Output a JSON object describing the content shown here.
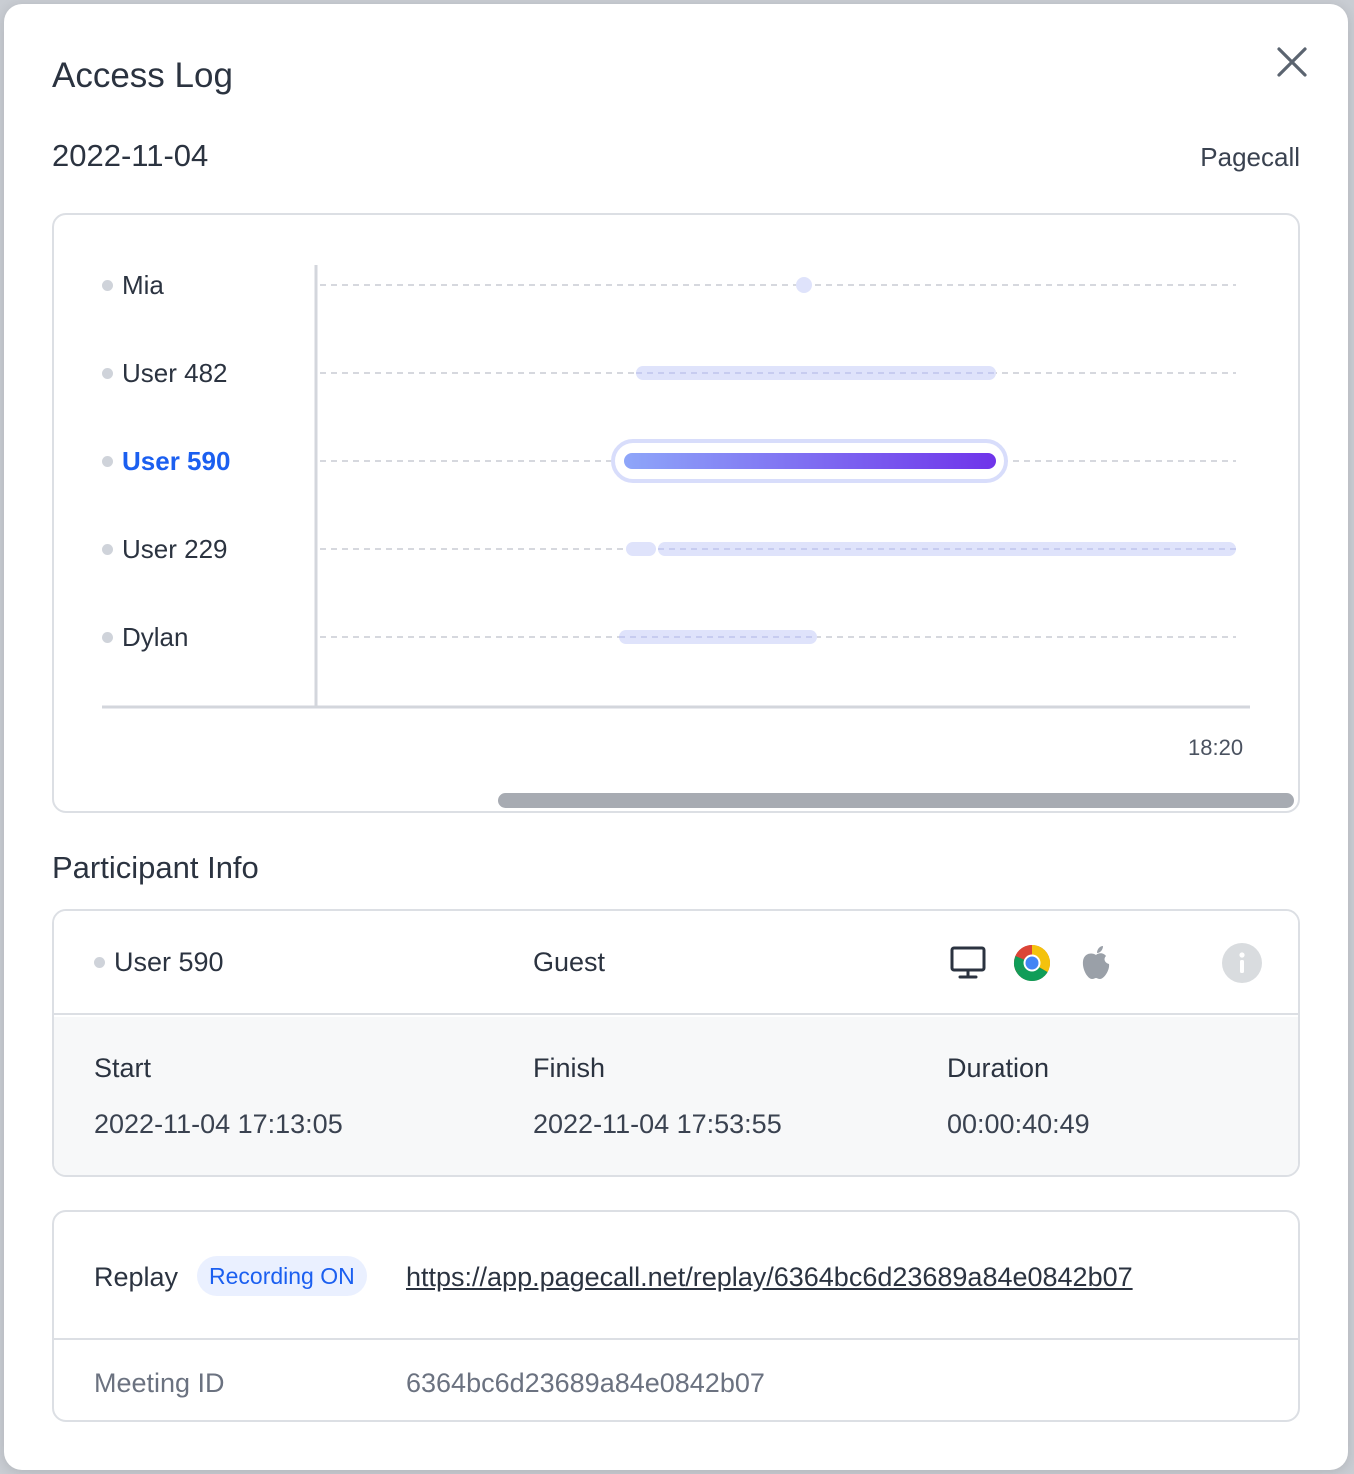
{
  "modal": {
    "title": "Access Log",
    "date": "2022-11-04",
    "brand": "Pagecall"
  },
  "timeline": {
    "participants": [
      {
        "name": "Mia",
        "active": false
      },
      {
        "name": "User 482",
        "active": false
      },
      {
        "name": "User 590",
        "active": true
      },
      {
        "name": "User 229",
        "active": false
      },
      {
        "name": "Dylan",
        "active": false
      }
    ],
    "tick_label": "18:20"
  },
  "participant_info": {
    "section_title": "Participant Info",
    "name": "User 590",
    "role": "Guest",
    "icons": [
      "monitor-icon",
      "chrome-icon",
      "apple-icon",
      "info-icon"
    ],
    "start_label": "Start",
    "start_value": "2022-11-04 17:13:05",
    "finish_label": "Finish",
    "finish_value": "2022-11-04 17:53:55",
    "duration_label": "Duration",
    "duration_value": "00:00:40:49"
  },
  "replay": {
    "label": "Replay",
    "badge": "Recording ON",
    "url": "https://app.pagecall.net/replay/6364bc6d23689a84e0842b07",
    "meeting_label": "Meeting ID",
    "meeting_id": "6364bc6d23689a84e0842b07"
  },
  "colors": {
    "accent": "#1b5ff0",
    "bar_light": "#dfe3fb",
    "bar_grad_start": "#8ea6f9",
    "bar_grad_end": "#6f34ea"
  }
}
